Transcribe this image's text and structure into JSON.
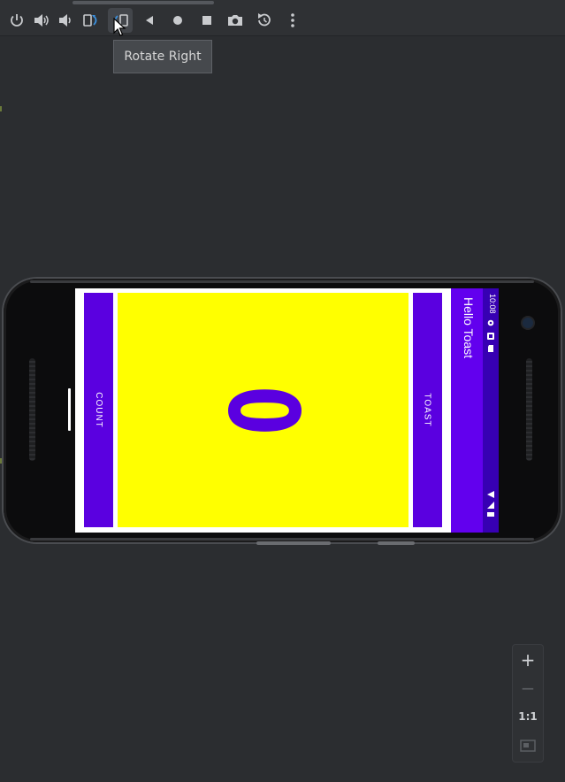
{
  "toolbar": {
    "buttons": [
      {
        "name": "power-icon"
      },
      {
        "name": "volume-up-icon"
      },
      {
        "name": "volume-down-icon"
      },
      {
        "name": "rotate-left-icon"
      },
      {
        "name": "rotate-right-icon",
        "active": true
      },
      {
        "name": "back-icon"
      },
      {
        "name": "home-icon"
      },
      {
        "name": "overview-icon"
      },
      {
        "name": "camera-icon"
      },
      {
        "name": "snapshot-icon"
      },
      {
        "name": "more-icon"
      }
    ],
    "tooltip": "Rotate Right"
  },
  "emulator": {
    "status_time": "10:08",
    "app_title": "Hello Toast",
    "count_button_label": "COUNT",
    "toast_button_label": "TOAST",
    "count_value": "0"
  },
  "zoom": {
    "zoom_in": "+",
    "zoom_out": "−",
    "actual_size": "1:1",
    "fit_icon": "fit-screen-icon"
  },
  "colors": {
    "primary": "#6200ee",
    "primary_dark": "#3700b3",
    "button": "#5a00e0",
    "count_background": "#ffff00",
    "ide_background": "#2b2d30"
  }
}
